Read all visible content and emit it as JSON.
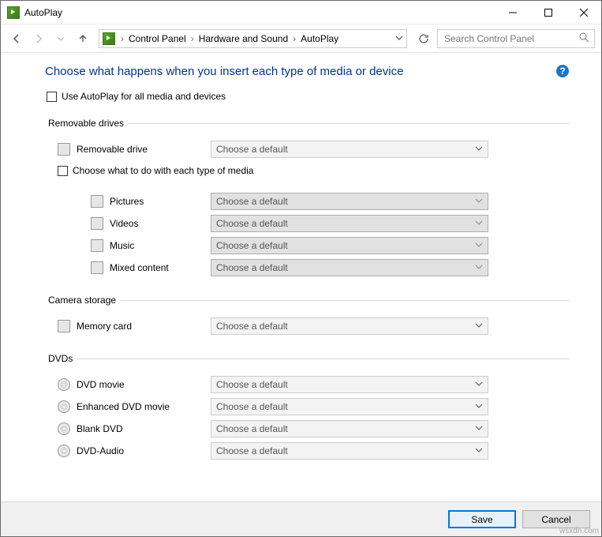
{
  "window": {
    "title": "AutoPlay"
  },
  "breadcrumb": {
    "items": [
      "Control Panel",
      "Hardware and Sound",
      "AutoPlay"
    ]
  },
  "search": {
    "placeholder": "Search Control Panel"
  },
  "pageTitle": "Choose what happens when you insert each type of media or device",
  "useAll": "Use AutoPlay for all media and devices",
  "chooseEach": "Choose what to do with each type of media",
  "ddDefault": "Choose a default",
  "sections": {
    "removable": {
      "legend": "Removable drives",
      "main": "Removable drive",
      "subs": [
        "Pictures",
        "Videos",
        "Music",
        "Mixed content"
      ]
    },
    "camera": {
      "legend": "Camera storage",
      "main": "Memory card"
    },
    "dvds": {
      "legend": "DVDs",
      "items": [
        "DVD movie",
        "Enhanced DVD movie",
        "Blank DVD",
        "DVD-Audio"
      ]
    }
  },
  "buttons": {
    "save": "Save",
    "cancel": "Cancel"
  },
  "watermark": "wsxdn.com"
}
